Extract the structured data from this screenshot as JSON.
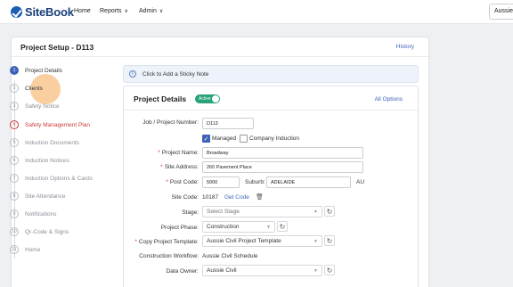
{
  "header": {
    "brand": "SiteBook",
    "nav": [
      "Home",
      "Reports",
      "Admin"
    ],
    "user_button": "Aussie"
  },
  "card": {
    "title": "Project Setup - D113",
    "history_link": "History"
  },
  "steps": [
    {
      "num": "1",
      "label": "Project Details",
      "state": "active"
    },
    {
      "num": "2",
      "label": "Clients",
      "state": "default"
    },
    {
      "num": "3",
      "label": "Safety Notice",
      "state": "default"
    },
    {
      "num": "X",
      "label": "Safety Management Plan",
      "state": "error"
    },
    {
      "num": "5",
      "label": "Induction Documents",
      "state": "default"
    },
    {
      "num": "6",
      "label": "Induction Notices",
      "state": "default"
    },
    {
      "num": "7",
      "label": "Induction Options & Cards",
      "state": "default"
    },
    {
      "num": "8",
      "label": "Site Attendance",
      "state": "default"
    },
    {
      "num": "9",
      "label": "Notifications",
      "state": "default"
    },
    {
      "num": "10",
      "label": "Qr-Code & Signs",
      "state": "default"
    },
    {
      "num": "11",
      "label": "Home",
      "state": "default"
    }
  ],
  "sticky_note": {
    "text": "Click to Add a Sticky Note"
  },
  "details": {
    "title": "Project Details",
    "status_toggle": "Active",
    "all_options": "All Options",
    "job_number_label": "Job / Project Number:",
    "job_number_value": "D113",
    "managed_label": "Managed",
    "company_induction_label": "Company Induction",
    "project_name_label": "Project Name:",
    "project_name_value": "Broadway",
    "site_address_label": "Site Address:",
    "site_address_value": "260 Pavement Place",
    "post_code_label": "Post Code:",
    "post_code_value": "5000",
    "suburb_label": "Suburb:",
    "suburb_value": "ADELAIDE",
    "state_value": "AU",
    "site_code_label": "Site Code:",
    "site_code_value": "10187",
    "get_code_link": "Get Code",
    "stage_label": "Stage:",
    "stage_value": "Select Stage",
    "phase_label": "Project Phase:",
    "phase_value": "Construction",
    "template_label": "Copy Project Template:",
    "template_value": "Aussie Civil Project Template",
    "workflow_label": "Construction Workflow:",
    "workflow_value": "Aussie Civil Schedule",
    "owner_label": "Data Owner:",
    "owner_value": "Aussie Civil"
  },
  "colors": {
    "brand": "#1b5fb4",
    "active_step": "#3d63b8",
    "error": "#cc3b3b",
    "toggle_active": "#27a27a",
    "link": "#3a63b8"
  },
  "icons": {
    "info": "info-icon",
    "refresh": "refresh-icon",
    "trash": "trash-icon",
    "chevron": "chevron-down-icon"
  }
}
